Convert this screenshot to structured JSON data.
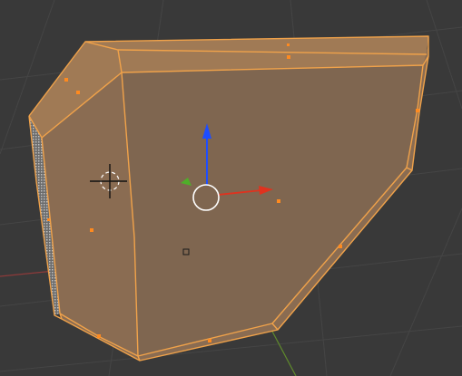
{
  "viewport": {
    "mode": "edit",
    "background": "#393939",
    "grid_line_color": "#454545",
    "x_axis_color": "#8e3a3a",
    "y_axis_color": "#5f8a2c"
  },
  "mesh": {
    "fill_color": "#7f6650",
    "side_fill_color": "#8a6c52",
    "top_fill_color": "#a07a55",
    "edge_color": "#f0a24a",
    "vertex_color": "#ff8a1f",
    "dotted_face_color": "#bfbfbf"
  },
  "gizmo": {
    "z_arrow_color": "#1d4dff",
    "x_arrow_color": "#e0321e",
    "y_arrow_color": "#4fae2a",
    "center_ring_color": "#ffffff"
  },
  "icons": {
    "cursor": "3d-cursor-icon",
    "move_gizmo": "move-manipulator-icon"
  }
}
